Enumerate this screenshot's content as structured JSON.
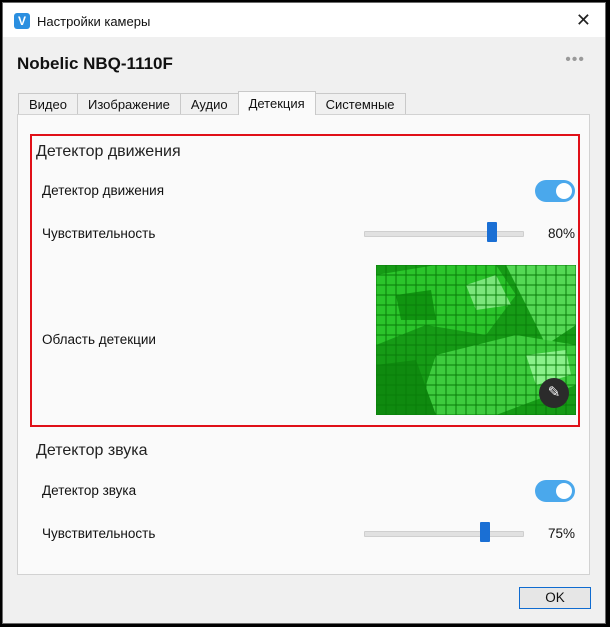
{
  "window": {
    "title": "Настройки камеры",
    "app_icon": "V",
    "close_glyph": "✕"
  },
  "header": {
    "camera_name": "Nobelic NBQ-1110F",
    "more_glyph": "•••"
  },
  "tabs": [
    {
      "label": "Видео"
    },
    {
      "label": "Изображение"
    },
    {
      "label": "Аудио"
    },
    {
      "label": "Детекция",
      "active": true
    },
    {
      "label": "Системные"
    }
  ],
  "motion": {
    "title": "Детектор движения",
    "toggle_label": "Детектор движения",
    "toggle_on": true,
    "sensitivity_label": "Чувствительность",
    "sensitivity_value": 80,
    "sensitivity_text": "80%",
    "area_label": "Область детекции",
    "edit_glyph": "✎"
  },
  "sound": {
    "title": "Детектор звука",
    "toggle_label": "Детектор звука",
    "toggle_on": true,
    "sensitivity_label": "Чувствительность",
    "sensitivity_value": 75,
    "sensitivity_text": "75%"
  },
  "footer": {
    "ok_label": "OK"
  },
  "colors": {
    "accent": "#4aa8ec",
    "slider": "#1a6fd4",
    "highlight": "#e01018",
    "grid_green": "#16a316"
  }
}
